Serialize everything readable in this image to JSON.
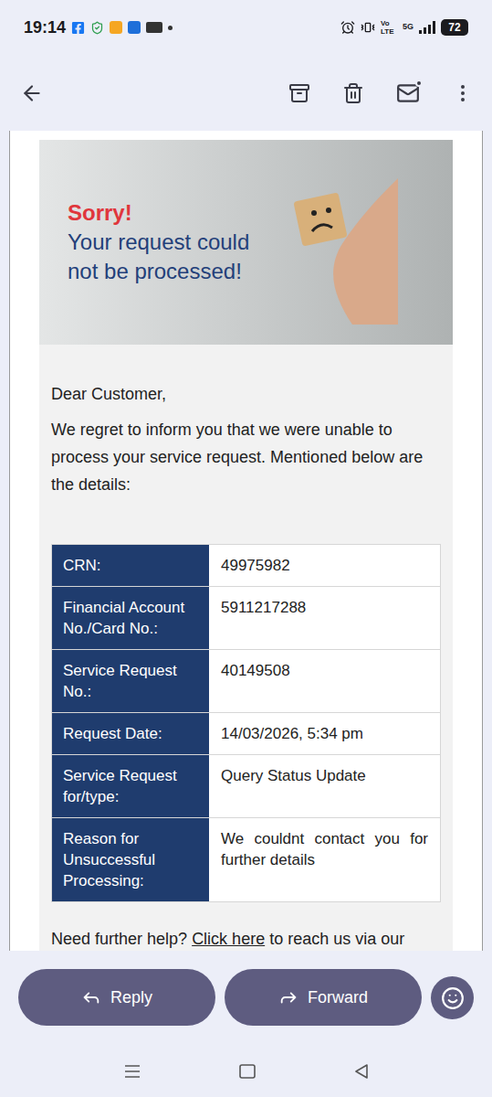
{
  "status_bar": {
    "time": "19:14",
    "network": "Vo LTE",
    "signal": "5G",
    "battery": "72"
  },
  "email": {
    "banner": {
      "title": "Sorry!",
      "subtitle": "Your request could not be processed!"
    },
    "greeting": "Dear Customer,",
    "intro": "We regret to inform you that we were unable to process your service request. Mentioned below are the details:",
    "details": [
      {
        "label": "CRN:",
        "value": "49975982"
      },
      {
        "label": "Financial Account No./Card No.:",
        "value": "5911217288"
      },
      {
        "label": "Service Request No.:",
        "value": "40149508"
      },
      {
        "label": "Request Date:",
        "value": "14/03/2026, 5:34 pm"
      },
      {
        "label": "Service Request for/type:",
        "value": "Query Status Update"
      },
      {
        "label": "Reason for Unsuccessful Processing:",
        "value": "We couldnt contact you for further details"
      }
    ],
    "footer": {
      "text": "Need further help?",
      "link": "Click here",
      "rest": "to reach us via our"
    }
  },
  "actions": [
    {
      "label": "Reply"
    },
    {
      "label": "Forward"
    }
  ]
}
